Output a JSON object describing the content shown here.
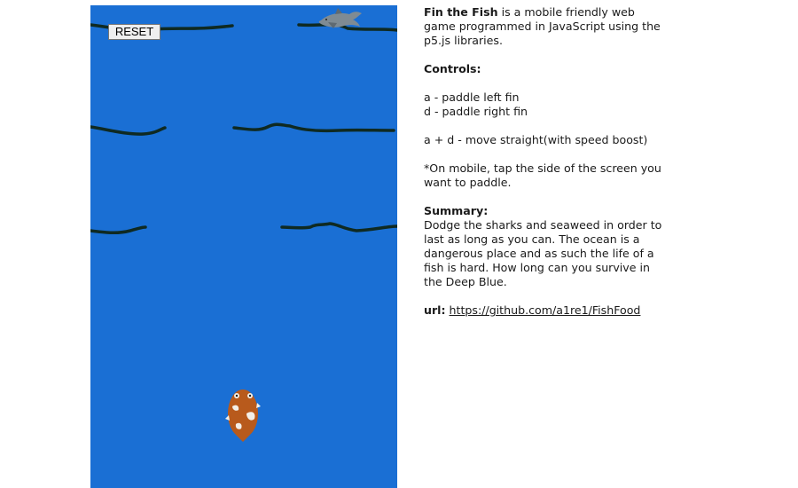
{
  "game": {
    "reset_label": "RESET",
    "colors": {
      "water": "#1a6fd4",
      "seaweed": "#0f2a22",
      "shark": "#7f8b93",
      "fish": "#b85a1c"
    },
    "icons": {
      "shark": "shark-icon",
      "fish": "fish-icon"
    }
  },
  "info": {
    "intro_title": "Fin the Fish",
    "intro_text": " is a mobile friendly web game programmed in JavaScript using the p5.js libraries.",
    "controls_heading": "Controls:",
    "control_a": "a - paddle left fin",
    "control_d": "d - paddle right fin",
    "control_ad": "a + d - move straight(with speed boost)",
    "mobile_note": "*On mobile, tap the side of the screen you want to paddle.",
    "summary_heading": "Summary:",
    "summary_text": "Dodge the sharks and seaweed in order to last as long as you can. The ocean is a dangerous place and as such the life of a fish is hard. How long can you survive in the Deep Blue.",
    "url_label": "url:",
    "url_link": "https://github.com/a1re1/FishFood"
  }
}
